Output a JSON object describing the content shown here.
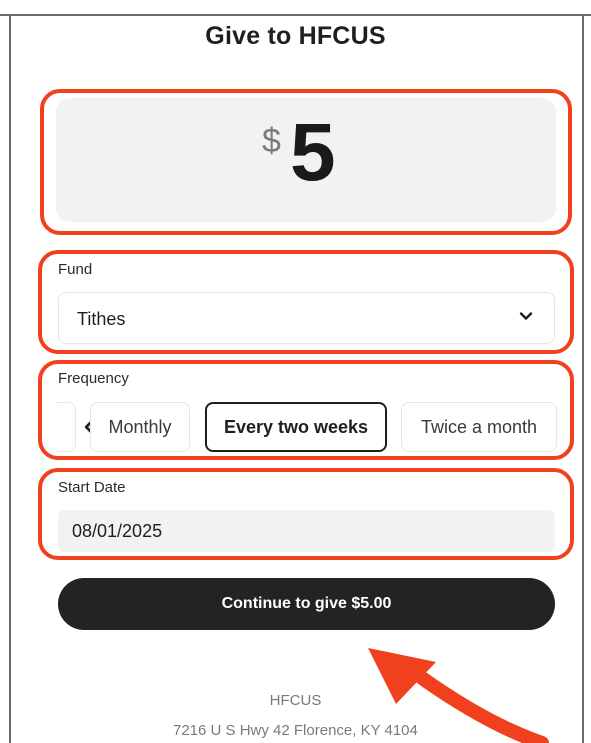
{
  "header": {
    "title": "Give to HFCUS"
  },
  "amount": {
    "currency": "$",
    "value": "5"
  },
  "fund": {
    "label": "Fund",
    "selected": "Tithes"
  },
  "frequency": {
    "label": "Frequency",
    "options": [
      "Monthly",
      "Every two weeks",
      "Twice a month"
    ],
    "selected": "Every two weeks"
  },
  "start_date": {
    "label": "Start Date",
    "value": "08/01/2025"
  },
  "actions": {
    "continue_label": "Continue to give $5.00"
  },
  "footer": {
    "org_name": "HFCUS",
    "address": "7216 U S Hwy 42 Florence, KY 4104"
  },
  "colors": {
    "highlight": "#f0401e",
    "button_bg": "#232323",
    "field_bg": "#f2f2f3"
  },
  "icons": [
    "chevron-down-icon",
    "chevron-left-icon",
    "annotation-arrow-icon"
  ]
}
